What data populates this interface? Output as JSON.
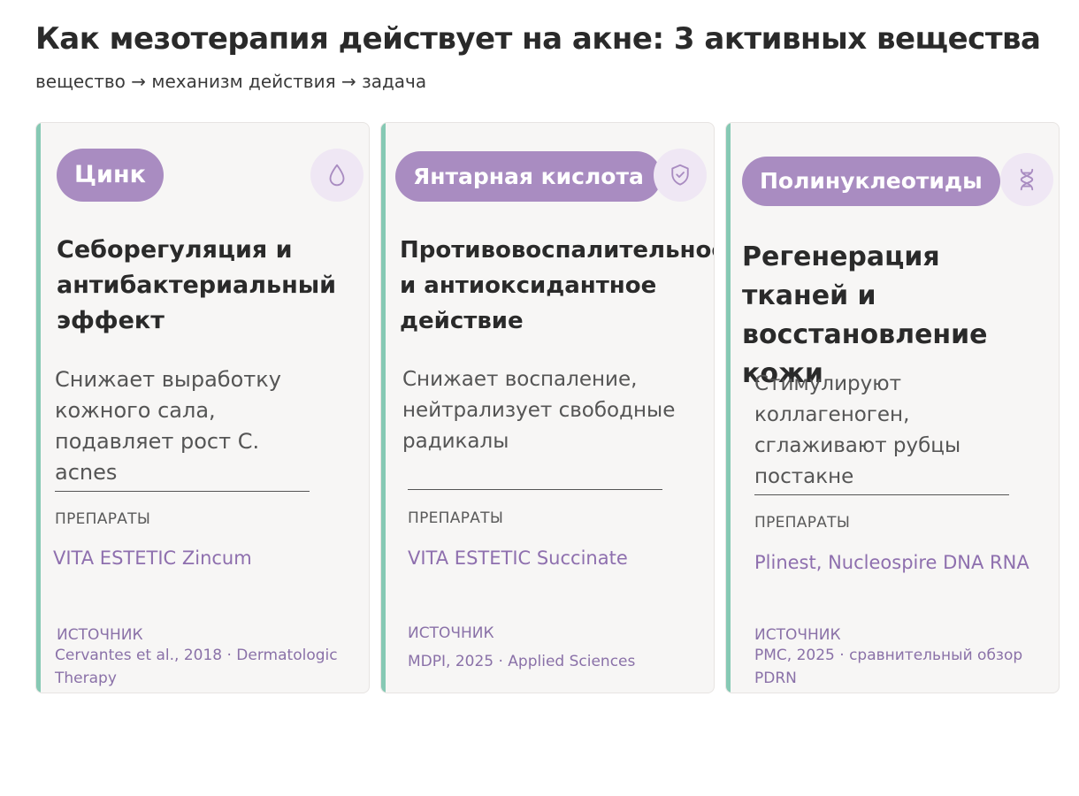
{
  "title": "Как мезотерапия действует на акне: 3 активных вещества",
  "subtitle": "вещество → механизм действия → задача",
  "cards": [
    {
      "substance": "Цинк",
      "icon": "droplet-icon",
      "heading": "Себорегуляция и антибактериальный эффект",
      "description": "Снижает выработку кожного сала, подавляет рост C. acnes",
      "drugs_label": "ПРЕПАРАТЫ",
      "drugs": "VITA ESTETIC Zincum",
      "source_label": "ИСТОЧНИК",
      "source": "Cervantes et al., 2018 · Dermatologic Therapy"
    },
    {
      "substance": "Янтарная кислота",
      "icon": "shield-check-icon",
      "heading": "Противовоспалительное и антиоксидантное действие",
      "description": "Снижает воспаление, нейтрализует свободные радикалы",
      "drugs_label": "ПРЕПАРАТЫ",
      "drugs": "VITA ESTETIC Succinate",
      "source_label": "ИСТОЧНИК",
      "source": "MDPI, 2025 · Applied Sciences"
    },
    {
      "substance": "Полинуклеотиды",
      "icon": "dna-icon",
      "heading": "Регенерация тканей и восстановление кожи",
      "description": "Стимулируют коллагеноген, сглаживают рубцы постакне",
      "drugs_label": "ПРЕПАРАТЫ",
      "drugs": "Plinest, Nucleospire DNA RNA",
      "source_label": "ИСТОЧНИК",
      "source": "PMC, 2025 · сравнительный обзор PDRN"
    }
  ],
  "colors": {
    "accent_bar": "#86c9b4",
    "pill": "#a98cc1",
    "icon_bg": "#efe7f4",
    "drug_text": "#8e6fae"
  }
}
